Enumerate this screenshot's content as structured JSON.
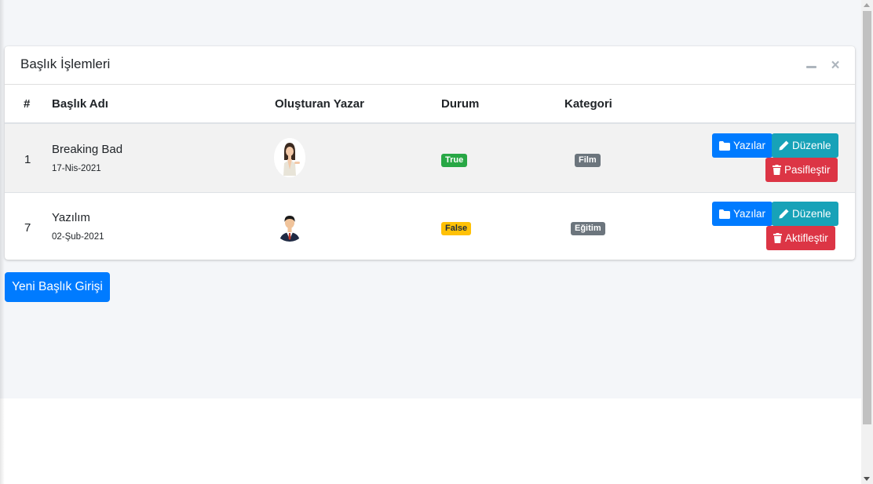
{
  "card": {
    "title": "Başlık İşlemleri"
  },
  "table": {
    "headers": {
      "index": "#",
      "title": "Başlık Adı",
      "author": "Oluşturan Yazar",
      "status": "Durum",
      "category": "Kategori"
    },
    "rows": [
      {
        "id": "1",
        "title": "Breaking Bad",
        "date": "17-Nis-2021",
        "status": "True",
        "status_color": "#28a745",
        "category": "Film",
        "author_avatar": "female-avatar",
        "actions": {
          "posts": "Yazılar",
          "edit": "Düzenle",
          "toggle": "Pasifleştir"
        }
      },
      {
        "id": "7",
        "title": "Yazılım",
        "date": "02-Şub-2021",
        "status": "False",
        "status_color": "#ffc107",
        "category": "Eğitim",
        "author_avatar": "male-avatar",
        "actions": {
          "posts": "Yazılar",
          "edit": "Düzenle",
          "toggle": "Aktifleştir"
        }
      }
    ]
  },
  "new_button": {
    "label": "Yeni Başlık Girişi"
  },
  "icons": {
    "posts": "folder-icon",
    "edit": "pencil-icon",
    "toggle": "trash-icon",
    "collapse": "minus-icon",
    "close": "close-icon"
  },
  "colors": {
    "primary": "#007bff",
    "info": "#17a2b8",
    "danger": "#dc3545",
    "secondary": "#6c757d"
  }
}
